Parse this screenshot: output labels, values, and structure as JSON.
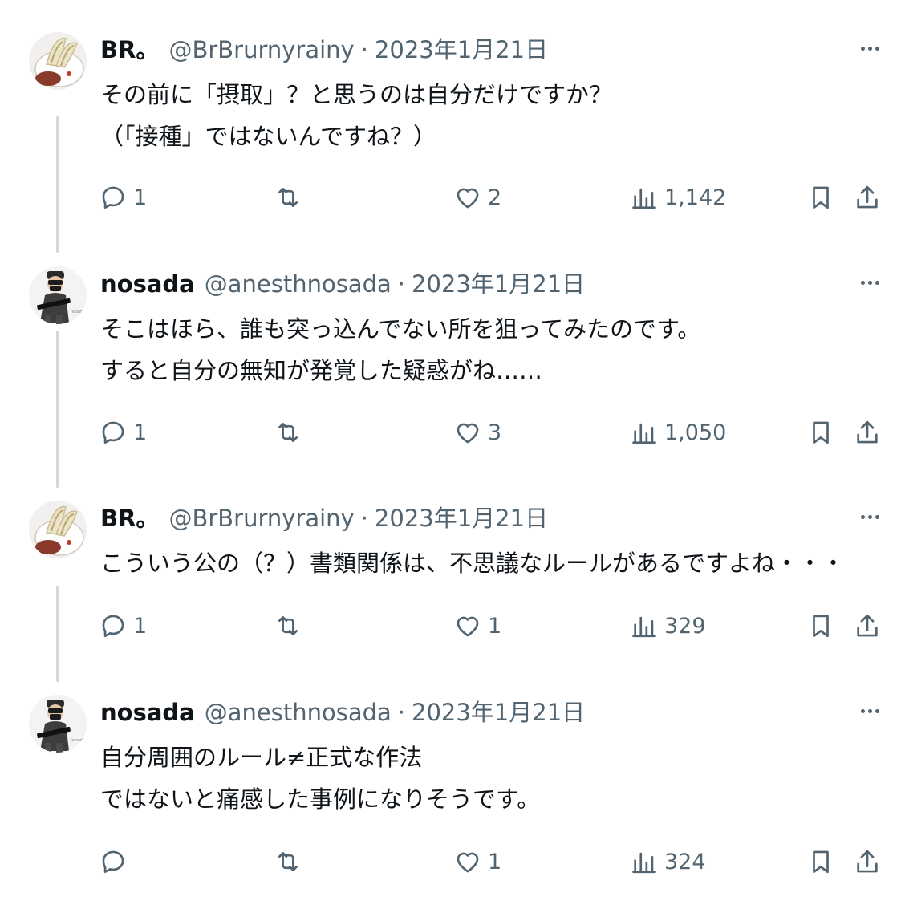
{
  "tweets": [
    {
      "name": "BR。",
      "handle": "@BrBrurnyrainy",
      "separator": "·",
      "date": "2023年1月21日",
      "lines": [
        "その前に「摂取」？と思うのは自分だけですか？",
        "（「接種」ではないんですね？）"
      ],
      "replies": "1",
      "retweets": "",
      "likes": "2",
      "views": "1,142"
    },
    {
      "name": "nosada",
      "handle": "@anesthnosada",
      "separator": "·",
      "date": "2023年1月21日",
      "lines": [
        "そこはほら、誰も突っ込んでない所を狙ってみたのです。",
        "すると自分の無知が発覚した疑惑がね……"
      ],
      "replies": "1",
      "retweets": "",
      "likes": "3",
      "views": "1,050"
    },
    {
      "name": "BR。",
      "handle": "@BrBrurnyrainy",
      "separator": "·",
      "date": "2023年1月21日",
      "lines": [
        "こういう公の（？）書類関係は、不思議なルールがあるですよね・・・"
      ],
      "replies": "1",
      "retweets": "",
      "likes": "1",
      "views": "329"
    },
    {
      "name": "nosada",
      "handle": "@anesthnosada",
      "separator": "·",
      "date": "2023年1月21日",
      "lines": [
        "自分周囲のルール≠正式な作法",
        "ではないと痛感した事例になりそうです。"
      ],
      "replies": "",
      "retweets": "",
      "likes": "1",
      "views": "324"
    }
  ],
  "icons": {
    "reply": "reply-icon",
    "retweet": "retweet-icon",
    "like": "like-icon",
    "views": "views-icon",
    "bookmark": "bookmark-icon",
    "share": "share-icon",
    "more": "more-icon"
  },
  "colors": {
    "text": "#0f1419",
    "secondary": "#536471",
    "thread_line": "#cfd9de",
    "background": "#ffffff"
  }
}
